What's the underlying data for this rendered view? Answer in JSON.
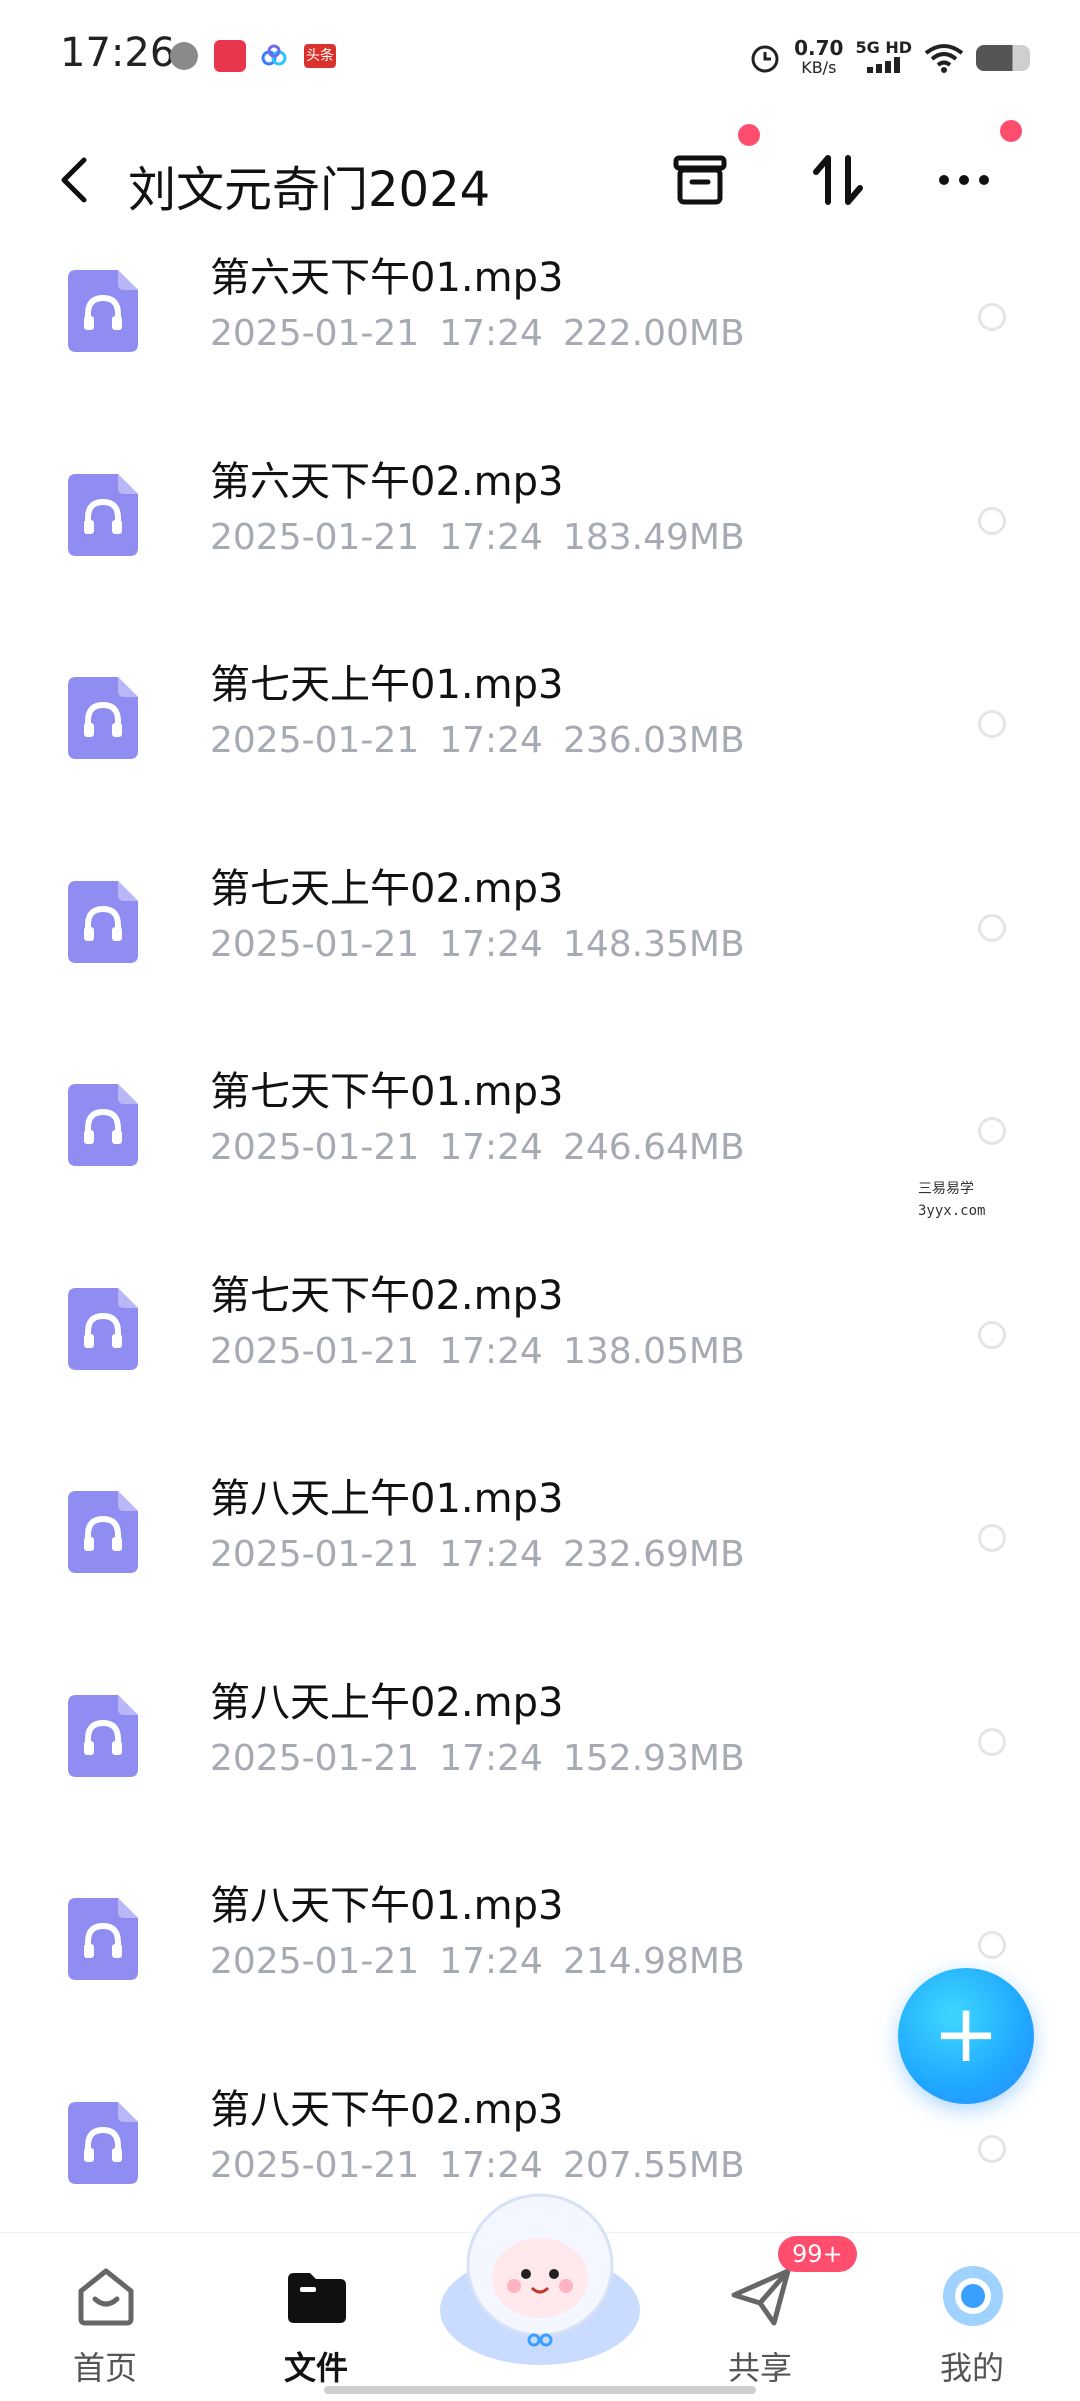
{
  "status_bar": {
    "time": "17:26",
    "speed_value": "0.70",
    "speed_unit": "KB/s",
    "network": "5G HD",
    "app3_label": "头条"
  },
  "header": {
    "title": "刘文元奇门2024"
  },
  "files": [
    {
      "name": "第六天下午01.mp3",
      "date": "2025-01-21",
      "time": "17:24",
      "size": "222.00MB"
    },
    {
      "name": "第六天下午02.mp3",
      "date": "2025-01-21",
      "time": "17:24",
      "size": "183.49MB"
    },
    {
      "name": "第七天上午01.mp3",
      "date": "2025-01-21",
      "time": "17:24",
      "size": "236.03MB"
    },
    {
      "name": "第七天上午02.mp3",
      "date": "2025-01-21",
      "time": "17:24",
      "size": "148.35MB"
    },
    {
      "name": "第七天下午01.mp3",
      "date": "2025-01-21",
      "time": "17:24",
      "size": "246.64MB"
    },
    {
      "name": "第七天下午02.mp3",
      "date": "2025-01-21",
      "time": "17:24",
      "size": "138.05MB"
    },
    {
      "name": "第八天上午01.mp3",
      "date": "2025-01-21",
      "time": "17:24",
      "size": "232.69MB"
    },
    {
      "name": "第八天上午02.mp3",
      "date": "2025-01-21",
      "time": "17:24",
      "size": "152.93MB"
    },
    {
      "name": "第八天下午01.mp3",
      "date": "2025-01-21",
      "time": "17:24",
      "size": "214.98MB"
    },
    {
      "name": "第八天下午02.mp3",
      "date": "2025-01-21",
      "time": "17:24",
      "size": "207.55MB"
    }
  ],
  "watermark": {
    "line1": "三易易学",
    "line2": "3yyx.com"
  },
  "fab": {
    "label": "+"
  },
  "bottom_nav": {
    "items": [
      {
        "label": "首页",
        "icon": "home-icon"
      },
      {
        "label": "文件",
        "icon": "folder-icon"
      },
      {
        "label": "共享",
        "icon": "paper-plane-icon"
      },
      {
        "label": "我的",
        "icon": "profile-icon"
      }
    ],
    "share_badge": "99+"
  },
  "colors": {
    "accent": "#1fa8ff",
    "file_icon": "#8f8cf2",
    "badge": "#ff4d6d",
    "meta_text": "#a6abb3"
  }
}
